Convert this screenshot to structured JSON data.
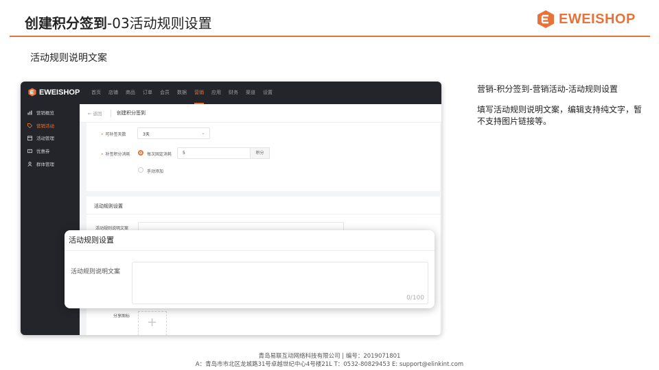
{
  "header": {
    "title_bold": "创建积分签到",
    "title_rest": "-03活动规则设置",
    "logo_text": "EWEISHOP",
    "brand_color": "#e8733a"
  },
  "subtitle": "活动规则说明文案",
  "app": {
    "logo_text": "EWEISHOP",
    "nav": [
      {
        "label": "首页"
      },
      {
        "label": "店铺"
      },
      {
        "label": "商品"
      },
      {
        "label": "订单"
      },
      {
        "label": "会员"
      },
      {
        "label": "数据"
      },
      {
        "label": "营销",
        "active": true
      },
      {
        "label": "应用"
      },
      {
        "label": "财务"
      },
      {
        "label": "渠道"
      },
      {
        "label": "设置"
      }
    ],
    "sidebar": [
      {
        "label": "营销概览",
        "icon": "chart-icon"
      },
      {
        "label": "营销活动",
        "icon": "tag-icon",
        "active": true
      },
      {
        "label": "活动管理",
        "icon": "calendar-icon"
      },
      {
        "label": "优惠券",
        "icon": "coupon-icon"
      },
      {
        "label": "群体管理",
        "icon": "group-icon"
      }
    ],
    "breadcrumb": {
      "back": "← 返回",
      "title": "创建积分签到"
    },
    "form": {
      "makeup_days_label": "可补签天数",
      "makeup_days_value": "3天",
      "makeup_cost_label": "补签积分消耗",
      "option_fixed": "每次固定消耗",
      "option_fixed_value": "5",
      "option_fixed_unit": "积分",
      "option_manual": "手动添加",
      "section_title": "活动规则设置",
      "rules_label": "活动规则说明文案",
      "share_label": "分享图标"
    }
  },
  "overlay": {
    "title": "活动规则设置",
    "label": "活动规则说明文案",
    "value": "",
    "counter": "0/100"
  },
  "notes": {
    "path": "营销-积分签到-营销活动-活动规则设置",
    "desc": "填写活动规则说明文案，编辑支持纯文字，暂不支持图片链接等。"
  },
  "footer": {
    "line1": "青岛易联互动网络科技有限公司 | 编号：2019071801",
    "line2": "A：青岛市市北区龙城路31号卓越世纪中心4号楼21L   T：0532-80829453   E: support@elinkint.com"
  }
}
